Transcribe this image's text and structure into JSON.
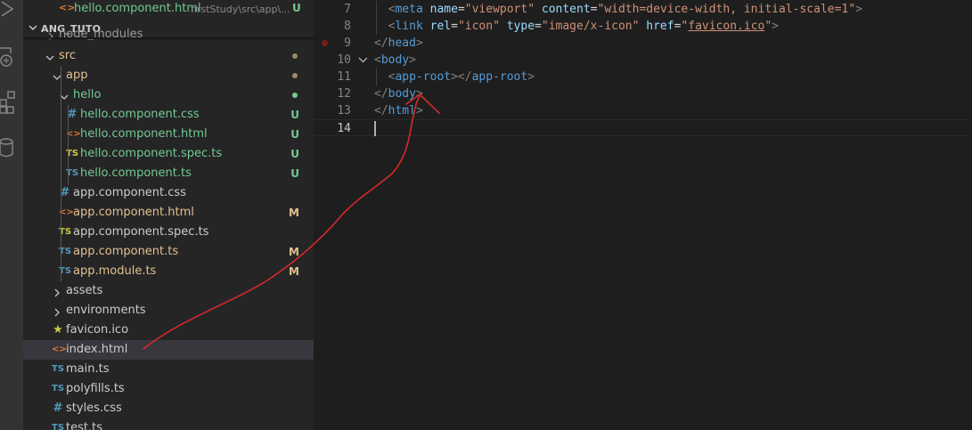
{
  "colors": {
    "git_untracked": "#73c991",
    "git_modified": "#e2c08d",
    "annotation": "#d42a2a"
  },
  "open_editor": {
    "filename": "hello.component.html",
    "path": "firstStudy\\src\\app\\...",
    "badge": "U"
  },
  "explorer": {
    "section_title": "ANG_TUTO",
    "partial_top_item": "node_modules",
    "tree": [
      {
        "name": "src",
        "type": "folder",
        "expanded": true,
        "status": "mod-dot"
      },
      {
        "name": "app",
        "type": "folder",
        "expanded": true,
        "status": "mod-dot"
      },
      {
        "name": "hello",
        "type": "folder",
        "expanded": true,
        "status": "new-dot"
      },
      {
        "name": "hello.component.css",
        "icon": "css",
        "badge": "U"
      },
      {
        "name": "hello.component.html",
        "icon": "html",
        "badge": "U"
      },
      {
        "name": "hello.component.spec.ts",
        "icon": "ts-spec",
        "badge": "U"
      },
      {
        "name": "hello.component.ts",
        "icon": "ts",
        "badge": "U"
      },
      {
        "name": "app.component.css",
        "icon": "css",
        "badge": ""
      },
      {
        "name": "app.component.html",
        "icon": "html",
        "badge": "M"
      },
      {
        "name": "app.component.spec.ts",
        "icon": "ts-spec",
        "badge": ""
      },
      {
        "name": "app.component.ts",
        "icon": "ts",
        "badge": "M"
      },
      {
        "name": "app.module.ts",
        "icon": "ts",
        "badge": "M"
      },
      {
        "name": "assets",
        "type": "folder",
        "expanded": false
      },
      {
        "name": "environments",
        "type": "folder",
        "expanded": false
      },
      {
        "name": "favicon.ico",
        "icon": "star"
      },
      {
        "name": "index.html",
        "icon": "html",
        "selected": true
      },
      {
        "name": "main.ts",
        "icon": "ts"
      },
      {
        "name": "polyfills.ts",
        "icon": "ts"
      },
      {
        "name": "styles.css",
        "icon": "css"
      },
      {
        "name": "test.ts",
        "icon": "ts"
      }
    ]
  },
  "editor": {
    "current_line": 14,
    "lines": [
      {
        "n": "7",
        "tokens": [
          [
            "ind",
            "  "
          ],
          [
            "br",
            "<"
          ],
          [
            "tag",
            "meta"
          ],
          [
            "txt",
            " "
          ],
          [
            "attr",
            "name"
          ],
          [
            "txt",
            "="
          ],
          [
            "str",
            "\"viewport\""
          ],
          [
            "txt",
            " "
          ],
          [
            "attr",
            "content"
          ],
          [
            "txt",
            "="
          ],
          [
            "str",
            "\"width=device-width, initial-scale=1\""
          ],
          [
            "br",
            ">"
          ]
        ]
      },
      {
        "n": "8",
        "tokens": [
          [
            "ind",
            "  "
          ],
          [
            "br",
            "<"
          ],
          [
            "tag",
            "link"
          ],
          [
            "txt",
            " "
          ],
          [
            "attr",
            "rel"
          ],
          [
            "txt",
            "="
          ],
          [
            "str",
            "\"icon\""
          ],
          [
            "txt",
            " "
          ],
          [
            "attr",
            "type"
          ],
          [
            "txt",
            "="
          ],
          [
            "str",
            "\"image/x-icon\""
          ],
          [
            "txt",
            " "
          ],
          [
            "attr",
            "href"
          ],
          [
            "txt",
            "="
          ],
          [
            "str",
            "\""
          ],
          [
            "link",
            "favicon.ico"
          ],
          [
            "str",
            "\""
          ],
          [
            "br",
            ">"
          ]
        ]
      },
      {
        "n": "9",
        "tokens": [
          [
            "br",
            "</"
          ],
          [
            "tag",
            "head"
          ],
          [
            "br",
            ">"
          ]
        ]
      },
      {
        "n": "10",
        "fold": true,
        "tokens": [
          [
            "br",
            "<"
          ],
          [
            "tag",
            "body"
          ],
          [
            "br",
            ">"
          ]
        ]
      },
      {
        "n": "11",
        "tokens": [
          [
            "ind",
            "  "
          ],
          [
            "br",
            "<"
          ],
          [
            "tag",
            "app-root"
          ],
          [
            "br",
            "></"
          ],
          [
            "tag",
            "app-root"
          ],
          [
            "br",
            ">"
          ]
        ]
      },
      {
        "n": "12",
        "tokens": [
          [
            "br",
            "</"
          ],
          [
            "tag",
            "body"
          ],
          [
            "br",
            ">"
          ]
        ]
      },
      {
        "n": "13",
        "tokens": [
          [
            "br",
            "</"
          ],
          [
            "tag",
            "html"
          ],
          [
            "br",
            ">"
          ]
        ]
      },
      {
        "n": "14",
        "tokens": []
      }
    ]
  }
}
